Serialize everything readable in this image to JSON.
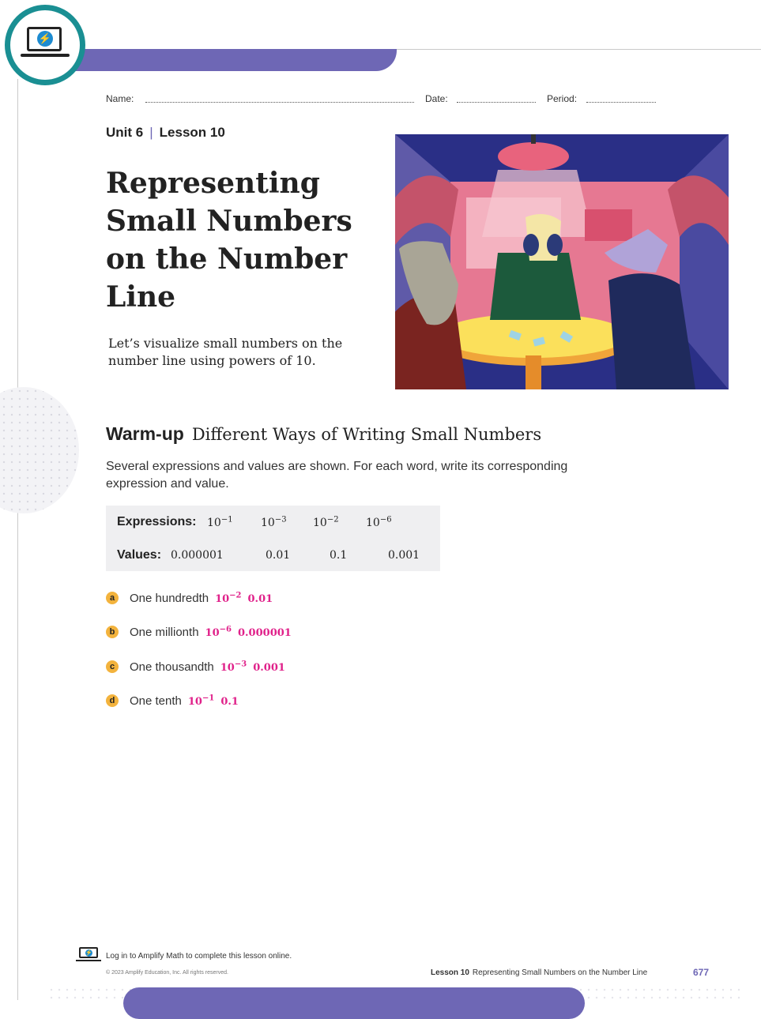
{
  "header": {
    "name_label": "Name:",
    "date_label": "Date:",
    "period_label": "Period:"
  },
  "lesson": {
    "unit": "Unit 6",
    "separator": "|",
    "lesson": "Lesson 10",
    "title": "Representing Small Numbers on the Number Line",
    "subtitle": "Let’s visualize small numbers on the number line using powers of 10."
  },
  "warmup": {
    "label": "Warm-up",
    "title": "Different Ways of Writing Small Numbers",
    "instructions": "Several expressions and values are shown. For each word, write its corresponding expression and value.",
    "expressions_label": "Expressions:",
    "expressions": [
      {
        "base": "10",
        "exp": "−1"
      },
      {
        "base": "10",
        "exp": "−3"
      },
      {
        "base": "10",
        "exp": "−2"
      },
      {
        "base": "10",
        "exp": "−6"
      }
    ],
    "values_label": "Values:",
    "values": [
      "0.000001",
      "0.01",
      "0.1",
      "0.001"
    ],
    "items": [
      {
        "letter": "a",
        "text": "One hundredth",
        "ans_base": "10",
        "ans_exp": "−2",
        "ans_value": "0.01"
      },
      {
        "letter": "b",
        "text": "One millionth",
        "ans_base": "10",
        "ans_exp": "−6",
        "ans_value": "0.000001"
      },
      {
        "letter": "c",
        "text": "One thousandth",
        "ans_base": "10",
        "ans_exp": "−3",
        "ans_value": "0.001"
      },
      {
        "letter": "d",
        "text": "One tenth",
        "ans_base": "10",
        "ans_exp": "−1",
        "ans_value": "0.1"
      }
    ]
  },
  "footer": {
    "login": "Log in to Amplify Math to complete this lesson online.",
    "copyright": "© 2023 Amplify Education, Inc. All rights reserved.",
    "lesson_label": "Lesson 10",
    "lesson_title": "Representing Small Numbers on the Number Line",
    "page": "677"
  },
  "colors": {
    "accent": "#6e67b5",
    "teal": "#1a8f93",
    "answer": "#e0218a",
    "letter_badge": "#f3b33d"
  },
  "icons": [
    "laptop-bolt-icon"
  ]
}
